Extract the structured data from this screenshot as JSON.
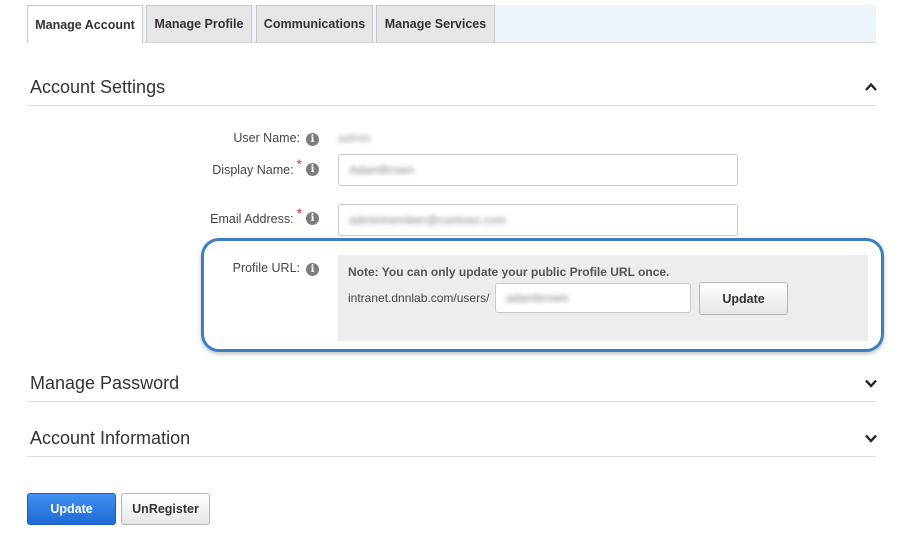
{
  "tabs": [
    {
      "label": "Manage Account",
      "active": true
    },
    {
      "label": "Manage Profile",
      "active": false
    },
    {
      "label": "Communications",
      "active": false
    },
    {
      "label": "Manage Services",
      "active": false
    }
  ],
  "sections": {
    "account_settings": {
      "title": "Account Settings",
      "expanded": true
    },
    "manage_password": {
      "title": "Manage Password",
      "expanded": false
    },
    "account_information": {
      "title": "Account Information",
      "expanded": false
    }
  },
  "form": {
    "user_name": {
      "label": "User Name:",
      "value": "admin"
    },
    "display_name": {
      "label": "Display Name:",
      "required_mark": "*",
      "value": "AdamBrown"
    },
    "email": {
      "label": "Email Address:",
      "required_mark": "*",
      "value": "adminmember@contoso.com"
    },
    "profile_url": {
      "label": "Profile URL:",
      "note": "Note: You can only update your public Profile URL once.",
      "prefix": "intranet.dnnlab.com/users/",
      "value": "adambrown",
      "update_label": "Update"
    }
  },
  "icons": {
    "info": "info-icon",
    "chevron_up": "chevron-up-icon",
    "chevron_down": "chevron-down-icon"
  },
  "buttons": {
    "update": "Update",
    "unregister": "UnRegister"
  },
  "colors": {
    "highlight": "#3e7cc4",
    "primary_button": "#2a78e4",
    "required": "#d9322f"
  }
}
